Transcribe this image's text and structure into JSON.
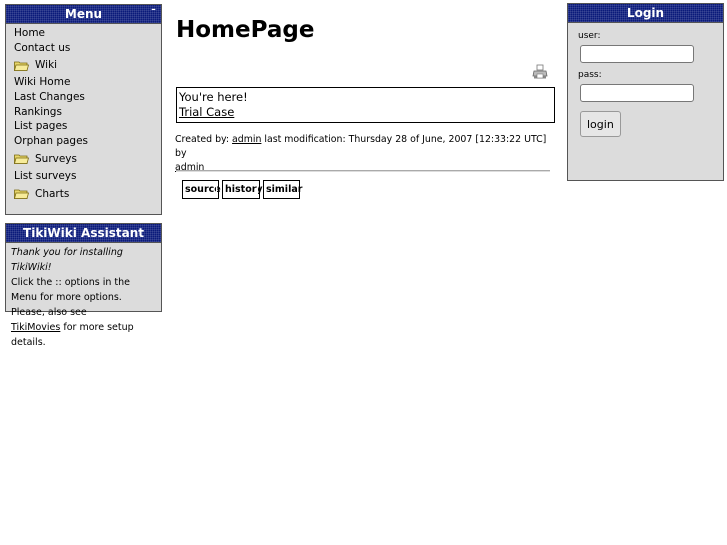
{
  "menu": {
    "title": "Menu",
    "collapse": "–",
    "items": [
      {
        "label": "Home",
        "folder": false
      },
      {
        "label": "Contact us",
        "folder": false
      },
      {
        "label": "Wiki",
        "folder": true
      },
      {
        "label": "Wiki Home",
        "folder": false
      },
      {
        "label": "Last Changes",
        "folder": false
      },
      {
        "label": "Rankings",
        "folder": false
      },
      {
        "label": "List pages",
        "folder": false
      },
      {
        "label": "Orphan pages",
        "folder": false
      },
      {
        "label": "Surveys",
        "folder": true
      },
      {
        "label": "List surveys",
        "folder": false
      },
      {
        "label": "Charts",
        "folder": true
      }
    ]
  },
  "assistant": {
    "title": "TikiWiki Assistant",
    "thanks": "Thank you for installing TikiWiki!",
    "text1": "Click the :: options in the Menu for more options. Please, also see",
    "link": "TikiMovies",
    "text2": "for more setup details."
  },
  "login": {
    "title": "Login",
    "user_label": "user:",
    "pass_label": "pass:",
    "user_value": "",
    "pass_value": "",
    "button": "login"
  },
  "page": {
    "title": "HomePage",
    "trail_prefix": "You're here!",
    "trail_link": "Trial Case",
    "created_by_label": "Created by:",
    "author": "admin",
    "modification_label": "last modification: Thursday 28 of June, 2007 [12:33:22 UTC] by",
    "modifier": "admin",
    "tabs": {
      "source": "source",
      "history": "history",
      "similar": "similar"
    }
  },
  "colors": {
    "title_bar": "#0a1a7a",
    "box_bg": "#dcdcdc"
  },
  "icons": {
    "folder": "folder-icon",
    "print": "print-icon"
  }
}
